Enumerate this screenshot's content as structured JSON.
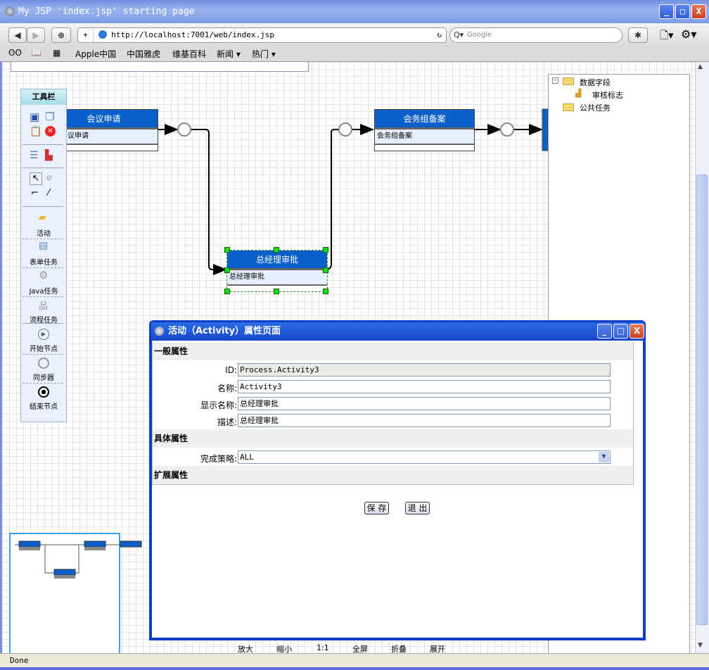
{
  "window": {
    "title": "My JSP 'index.jsp' starting page"
  },
  "browser": {
    "url": "http://localhost:7001/web/index.jsp",
    "search_placeholder": "Google",
    "bookmarks": [
      "Apple中国",
      "中国雅虎",
      "维基百科",
      "新闻 ▾",
      "热门 ▾"
    ]
  },
  "toolbox": {
    "title": "工具栏",
    "items": [
      "活动",
      "表单任务",
      "Java任务",
      "流程任务",
      "开始节点",
      "同步器",
      "结束节点"
    ]
  },
  "tree": {
    "items": [
      "数据字段",
      "审核标志",
      "公共任务"
    ]
  },
  "diagram": {
    "nodes": [
      {
        "title": "会议申请",
        "body": "议申请"
      },
      {
        "title": "总经理审批",
        "body": "总经理审批"
      },
      {
        "title": "会务组备案",
        "body": "会务组备案"
      }
    ],
    "accent": "#0a5fc9"
  },
  "zoombar": [
    "放大",
    "缩小",
    "1:1",
    "全屏",
    "折叠",
    "展开"
  ],
  "dialog": {
    "title": "活动（Activity）属性页面",
    "sections": [
      "一般属性",
      "具体属性",
      "扩展属性"
    ],
    "fields": [
      {
        "label": "ID:",
        "value": "Process.Activity3"
      },
      {
        "label": "名称:",
        "value": "Activity3"
      },
      {
        "label": "显示名称:",
        "value": "总经理审批"
      },
      {
        "label": "描述:",
        "value": "总经理审批"
      }
    ],
    "strategy": {
      "label": "完成策略:",
      "value": "ALL"
    },
    "save": "保 存",
    "exit": "退 出"
  },
  "status": "Done"
}
